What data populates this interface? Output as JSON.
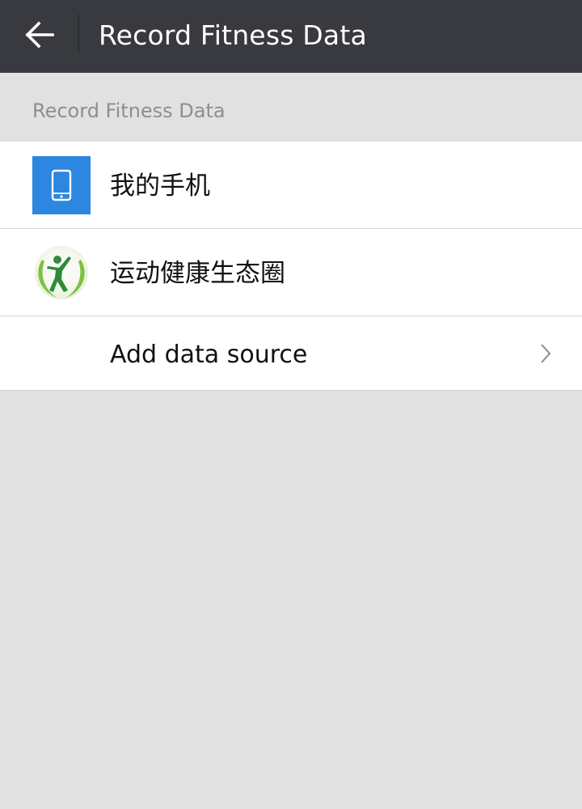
{
  "appbar": {
    "title": "Record Fitness Data",
    "back_icon": "arrow-left-icon",
    "background": "#393a3f"
  },
  "section": {
    "header": "Record Fitness Data"
  },
  "sources": [
    {
      "label": "我的手机",
      "icon": "phone-icon",
      "icon_color": "#2b87e0"
    },
    {
      "label": "运动健康生态圈",
      "icon": "fitness-ecosystem-logo-icon",
      "icon_color": "#7dc142"
    }
  ],
  "add_source": {
    "label": "Add data source",
    "icon": "chevron-right-icon"
  }
}
